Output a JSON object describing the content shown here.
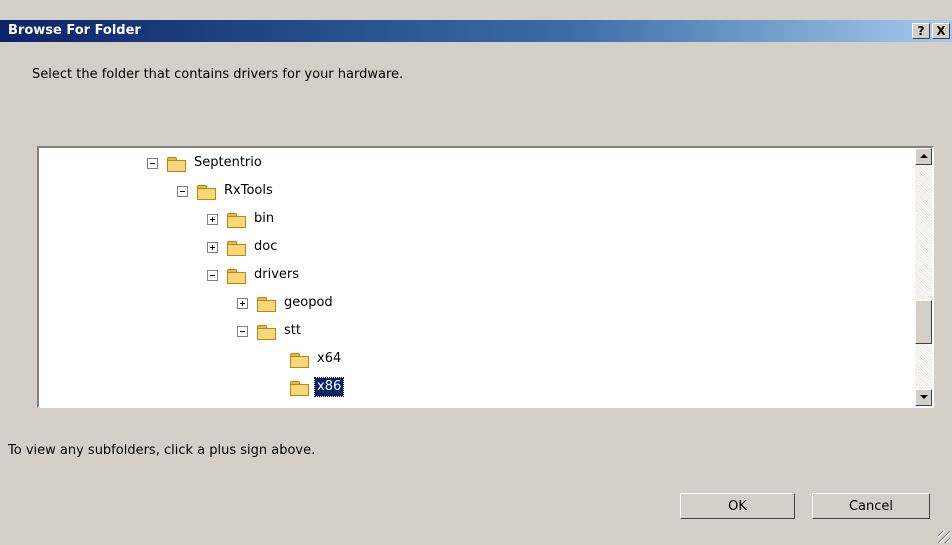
{
  "dialog": {
    "title": "Browse For Folder",
    "help_label": "?",
    "close_label": "X",
    "instruction": "Select the folder that contains drivers for your hardware.",
    "hint": "To view any subfolders, click a plus sign above.",
    "ok_label": "OK",
    "cancel_label": "Cancel"
  },
  "tree": {
    "nodes": [
      {
        "label": "Septentrio",
        "expander": "minus",
        "selected": false
      },
      {
        "label": "RxTools",
        "expander": "minus",
        "selected": false
      },
      {
        "label": "bin",
        "expander": "plus",
        "selected": false
      },
      {
        "label": "doc",
        "expander": "plus",
        "selected": false
      },
      {
        "label": "drivers",
        "expander": "minus",
        "selected": false
      },
      {
        "label": "geopod",
        "expander": "plus",
        "selected": false
      },
      {
        "label": "stt",
        "expander": "minus",
        "selected": false
      },
      {
        "label": "x64",
        "expander": "none",
        "selected": false
      },
      {
        "label": "x86",
        "expander": "none",
        "selected": true
      }
    ]
  },
  "colors": {
    "titlebar_start": "#0a246a",
    "titlebar_end": "#a6caf0",
    "selection": "#0a246a",
    "folder": "#f7d779",
    "dialog_face": "#d4d0c8"
  },
  "icons": {
    "folder": "folder-icon",
    "expand": "plus-box-icon",
    "collapse": "minus-box-icon"
  }
}
